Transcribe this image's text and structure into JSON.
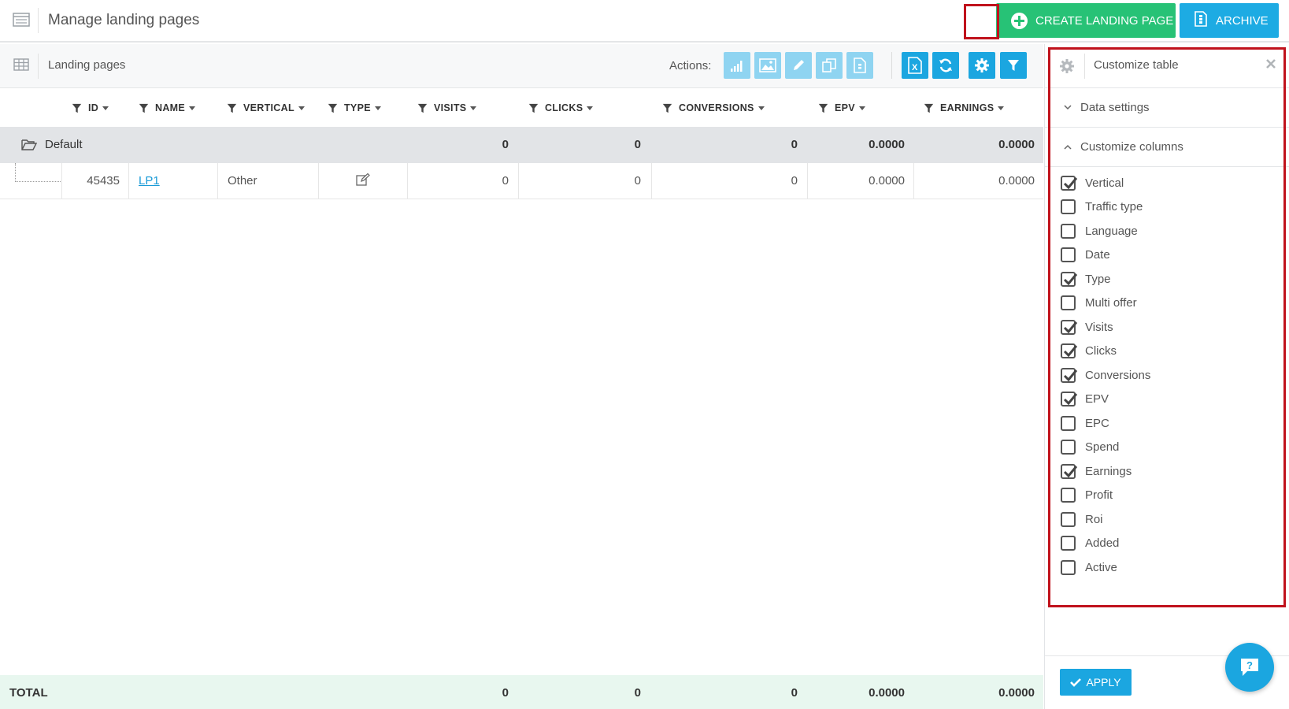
{
  "header": {
    "title": "Manage landing pages",
    "create_label": "CREATE LANDING PAGE",
    "archive_label": "ARCHIVE"
  },
  "toolbar": {
    "section_label": "Landing pages",
    "actions_label": "Actions:",
    "action_icons": [
      "stats-icon",
      "image-icon",
      "edit-icon",
      "duplicate-icon",
      "report-icon"
    ],
    "tool_icons": [
      "export-excel-icon",
      "refresh-icon",
      "settings-icon",
      "filter-icon"
    ]
  },
  "table": {
    "columns": [
      "ID",
      "NAME",
      "VERTICAL",
      "TYPE",
      "VISITS",
      "CLICKS",
      "CONVERSIONS",
      "EPV",
      "EARNINGS"
    ],
    "group": {
      "name": "Default",
      "visits": "0",
      "clicks": "0",
      "conversions": "0",
      "epv": "0.0000",
      "earnings": "0.0000"
    },
    "rows": [
      {
        "id": "45435",
        "name": "LP1",
        "vertical": "Other",
        "visits": "0",
        "clicks": "0",
        "conversions": "0",
        "epv": "0.0000",
        "earnings": "0.0000"
      }
    ],
    "total": {
      "label": "TOTAL",
      "visits": "0",
      "clicks": "0",
      "conversions": "0",
      "epv": "0.0000",
      "earnings": "0.0000"
    }
  },
  "panel": {
    "title": "Customize table",
    "data_settings_label": "Data settings",
    "customize_columns_label": "Customize columns",
    "columns": [
      {
        "label": "Vertical",
        "checked": true
      },
      {
        "label": "Traffic type",
        "checked": false
      },
      {
        "label": "Language",
        "checked": false
      },
      {
        "label": "Date",
        "checked": false
      },
      {
        "label": "Type",
        "checked": true
      },
      {
        "label": "Multi offer",
        "checked": false
      },
      {
        "label": "Visits",
        "checked": true
      },
      {
        "label": "Clicks",
        "checked": true
      },
      {
        "label": "Conversions",
        "checked": true
      },
      {
        "label": "EPV",
        "checked": true
      },
      {
        "label": "EPC",
        "checked": false
      },
      {
        "label": "Spend",
        "checked": false
      },
      {
        "label": "Earnings",
        "checked": true
      },
      {
        "label": "Profit",
        "checked": false
      },
      {
        "label": "Roi",
        "checked": false
      },
      {
        "label": "Added",
        "checked": false
      },
      {
        "label": "Active",
        "checked": false
      }
    ],
    "apply_label": "APPLY"
  },
  "colors": {
    "green": "#27c276",
    "blue": "#1ba6e0",
    "light_blue": "#8fd4f1",
    "highlight_red": "#c0121c",
    "total_bg": "#e8f7ef",
    "group_bg": "#e2e4e7",
    "link": "#1a9bd7"
  }
}
